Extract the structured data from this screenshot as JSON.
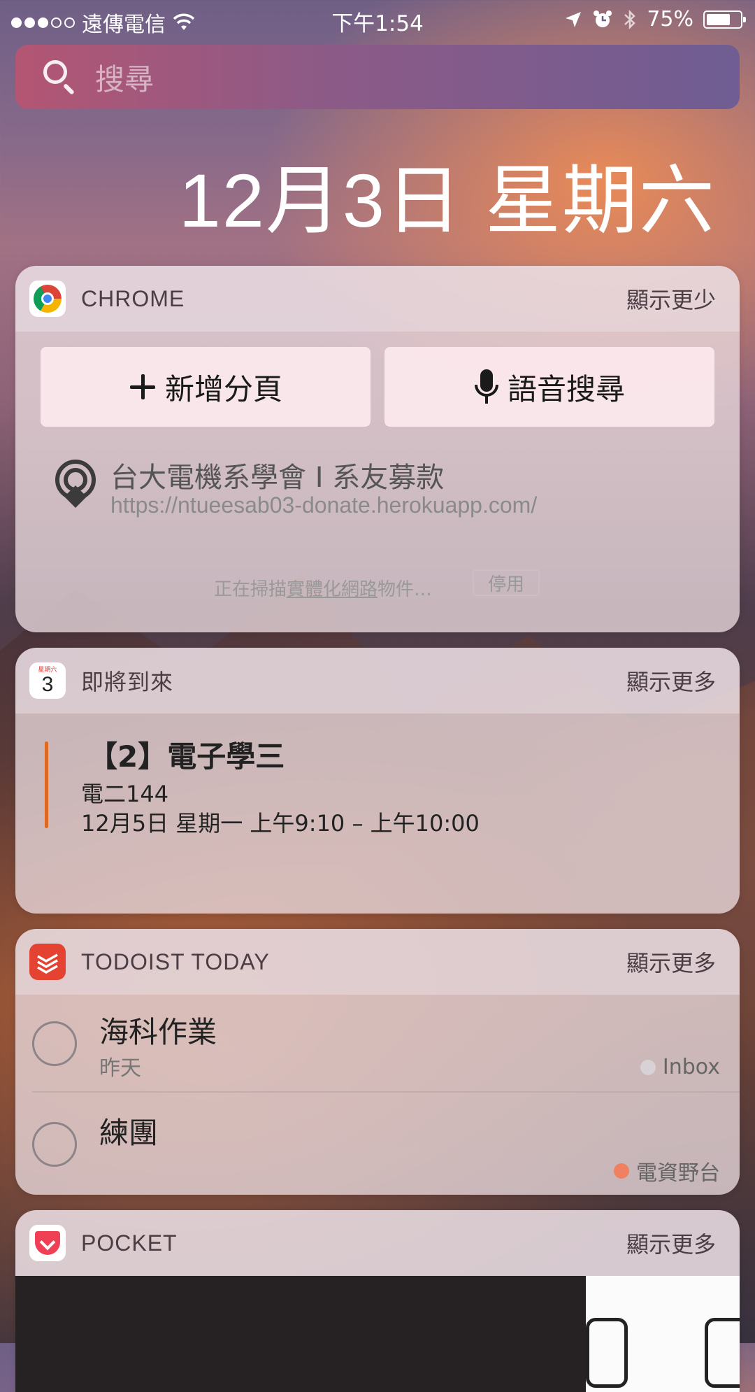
{
  "status_bar": {
    "signal_dots": 5,
    "signal_filled": 3,
    "carrier": "遠傳電信",
    "time": "下午1:54",
    "battery_percent": 75,
    "battery_text": "75%"
  },
  "search": {
    "placeholder": "搜尋"
  },
  "date_heading": "12月3日 星期六",
  "chrome_widget": {
    "title": "CHROME",
    "toggle": "顯示更少",
    "new_tab": "新增分頁",
    "voice_search": "語音搜尋",
    "nearby": {
      "title": "台大電機系學會 I 系友募款",
      "url": "https://ntueesab03-donate.herokuapp.com/"
    },
    "scan": {
      "prefix": "正在掃描",
      "link": "實體化網路",
      "suffix": "物件…",
      "stop": "停用"
    }
  },
  "calendar_widget": {
    "icon_weekday": "星期六",
    "icon_day": "3",
    "title": "即將到來",
    "toggle": "顯示更多",
    "event": {
      "title": "【2】電子學三",
      "location": "電二144",
      "time": "12月5日 星期一 上午9:10 – 上午10:00",
      "color": "#e0671f"
    }
  },
  "todoist_widget": {
    "title": "TODOIST TODAY",
    "toggle": "顯示更多",
    "tasks": [
      {
        "name": "海科作業",
        "due": "昨天",
        "project": "Inbox",
        "project_color": "#d8d2d6"
      },
      {
        "name": "練團",
        "due": "",
        "project": "電資野台",
        "project_color": "#f08060"
      }
    ]
  },
  "pocket_widget": {
    "title": "POCKET",
    "toggle": "顯示更多"
  }
}
